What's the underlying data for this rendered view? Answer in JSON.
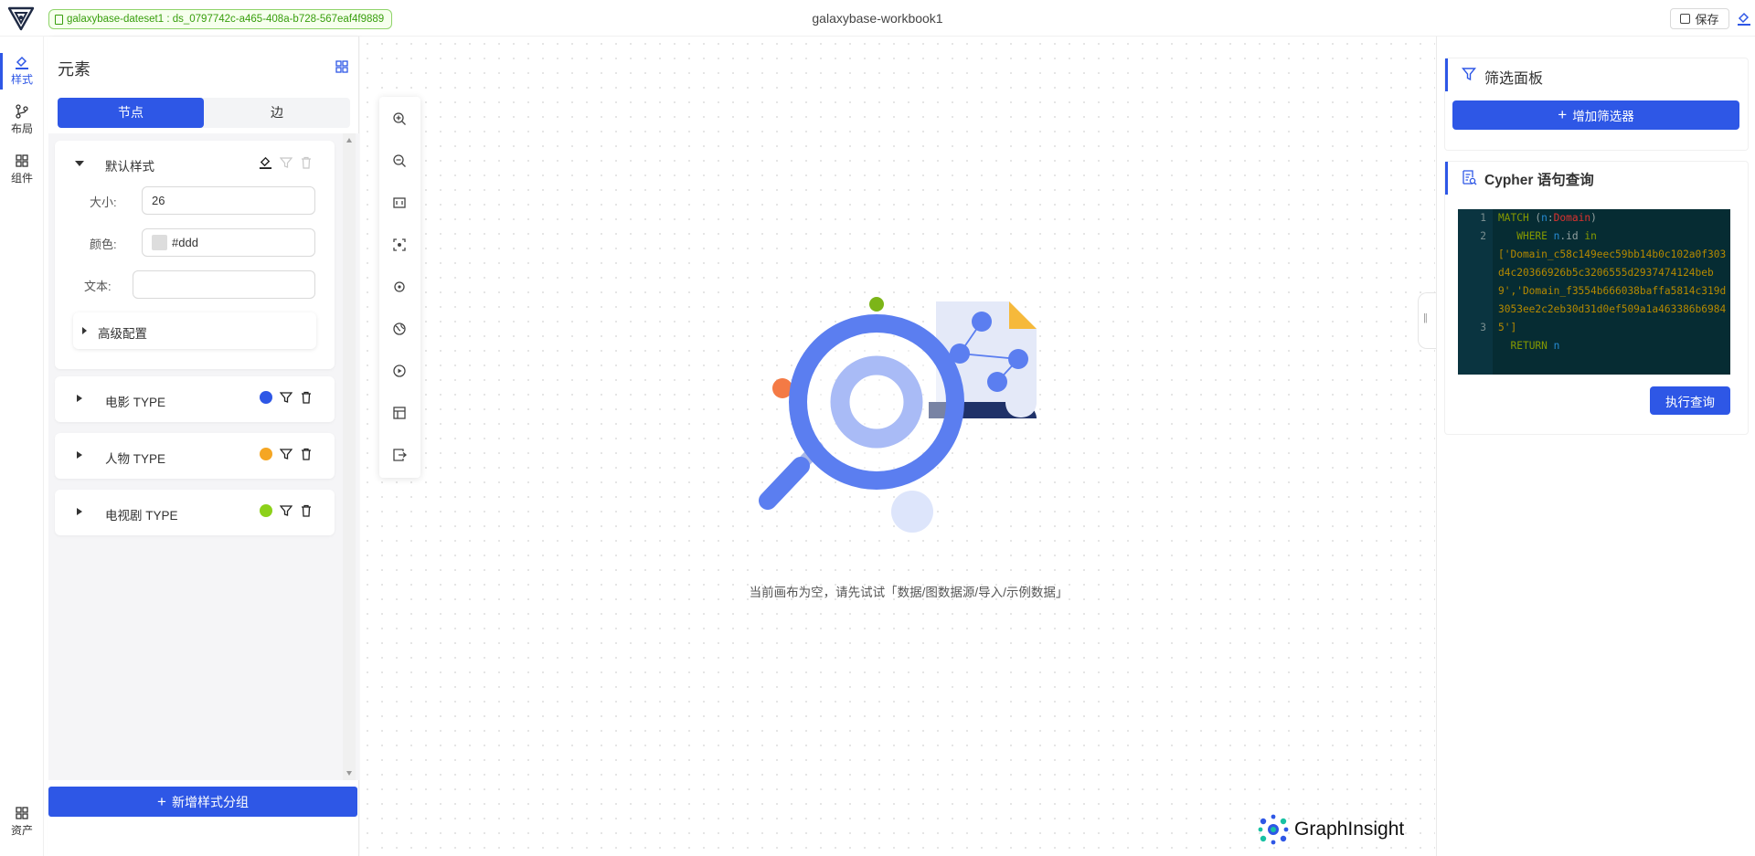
{
  "header": {
    "dataset_label": "galaxybase-dateset1 : ds_0797742c-a465-408a-b728-567eaf4f9889",
    "workbook_title": "galaxybase-workbook1",
    "save_label": "保存"
  },
  "rail": {
    "items": [
      {
        "label": "样式",
        "icon": "paint-bucket-icon",
        "active": true
      },
      {
        "label": "布局",
        "icon": "branch-icon",
        "active": false
      },
      {
        "label": "组件",
        "icon": "grid-icon",
        "active": false
      }
    ],
    "bottom": {
      "label": "资产",
      "icon": "grid-icon"
    }
  },
  "style_panel": {
    "title": "元素",
    "tabs": [
      {
        "label": "节点",
        "active": true
      },
      {
        "label": "边",
        "active": false
      }
    ],
    "default_style": {
      "title": "默认样式",
      "size_label": "大小:",
      "size_value": "26",
      "color_label": "颜色:",
      "color_value": "#ddd",
      "text_label": "文本:",
      "text_value": "",
      "advanced_label": "高级配置"
    },
    "groups": [
      {
        "title": "电影 TYPE",
        "color": "#2e57e6"
      },
      {
        "title": "人物 TYPE",
        "color": "#f5a623"
      },
      {
        "title": "电视剧 TYPE",
        "color": "#8dd11a"
      }
    ],
    "add_group_label": "新增样式分组"
  },
  "canvas": {
    "empty_message": "当前画布为空，请先试试「数据/图数据源/导入/示例数据」",
    "brand": "GraphInsight",
    "toolbar_icons": [
      "zoom-in-icon",
      "zoom-out-icon",
      "fit-view-icon",
      "focus-icon",
      "rotate-icon",
      "globe-icon",
      "play-icon",
      "layout-icon",
      "export-icon"
    ]
  },
  "right_panel": {
    "filter": {
      "title": "筛选面板",
      "add_label": "增加筛选器"
    },
    "cypher": {
      "title": "Cypher 语句查询",
      "run_label": "执行查询",
      "line_numbers": [
        "1",
        "2",
        "",
        "",
        "",
        "",
        "3"
      ],
      "code": {
        "l1_kw": "MATCH",
        "l1_var": "n",
        "l1_label": "Domain",
        "l2_kw": "WHERE",
        "l2_var": "n",
        "l2_prop": ".id",
        "l2_in": "in",
        "l2_str": "['Domain_c58c149eec59bb14b0c102a0f303d4c20366926b5c3206555d2937474124beb9','Domain_f3554b666038baffa5814c319d3053ee2c2eb30d31d0ef509a1a463386b69845']",
        "l3_kw": "RETURN",
        "l3_var": "n"
      }
    }
  }
}
